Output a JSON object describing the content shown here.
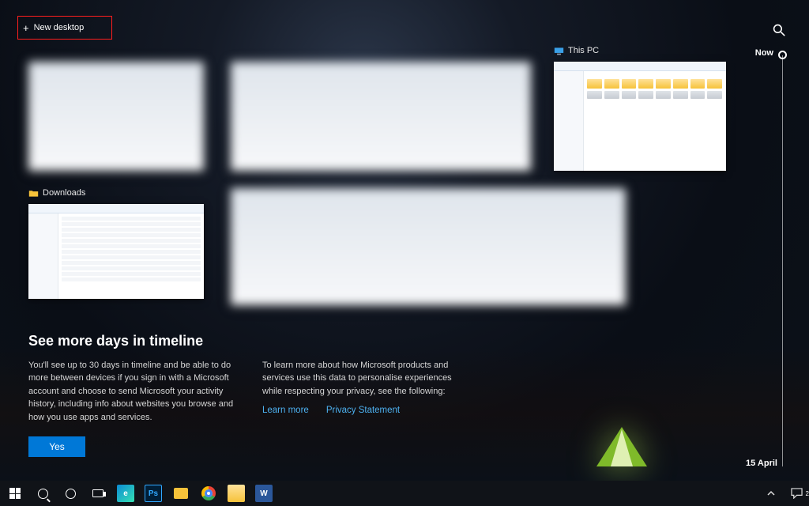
{
  "new_desktop_label": "New desktop",
  "timeline": {
    "now_label": "Now",
    "bottom_date": "15 April"
  },
  "thumbnails": {
    "third_title": "This PC",
    "fourth_title": "Downloads"
  },
  "panel": {
    "heading": "See more days in timeline",
    "body_left": "You'll see up to 30 days in timeline and be able to do more between devices if you sign in with a Microsoft account and choose to send Microsoft your activity history, including info about websites you browse and how you use apps and services.",
    "body_right": "To learn more about how Microsoft products and services use this data to personalise experiences while respecting your privacy, see the following:",
    "link_learn": "Learn more",
    "link_privacy": "Privacy Statement",
    "yes_label": "Yes"
  },
  "taskbar": {
    "tooltips": {
      "start": "Start",
      "search": "Search",
      "cortana": "Cortana",
      "taskview": "Task View",
      "edge": "Microsoft Edge",
      "photoshop": "Adobe Photoshop",
      "explorer": "File Explorer",
      "chrome": "Google Chrome",
      "folder": "File Explorer",
      "word": "Word"
    },
    "notification_count": "2"
  }
}
